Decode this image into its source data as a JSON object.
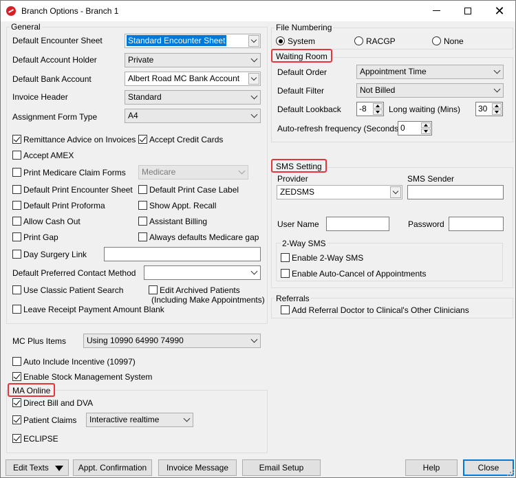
{
  "window": {
    "title": "Branch Options - Branch 1"
  },
  "general": {
    "legend": "General",
    "default_encounter_sheet": {
      "label": "Default Encounter Sheet",
      "value": "Standard Encounter Sheet"
    },
    "default_account_holder": {
      "label": "Default Account Holder",
      "value": "Private"
    },
    "default_bank_account": {
      "label": "Default Bank Account",
      "value": "Albert Road MC Bank Account"
    },
    "invoice_header": {
      "label": "Invoice Header",
      "value": "Standard"
    },
    "assignment_form_type": {
      "label": "Assignment Form Type",
      "value": "A4"
    },
    "remittance_advice": {
      "label": "Remittance Advice on Invoices",
      "checked": true
    },
    "accept_credit_cards": {
      "label": "Accept Credit Cards",
      "checked": true
    },
    "accept_amex": {
      "label": "Accept AMEX",
      "checked": false
    },
    "print_medicare_claim_forms": {
      "label": "Print Medicare Claim Forms",
      "checked": false
    },
    "medicare_select": {
      "value": "Medicare"
    },
    "default_print_encounter_sheet": {
      "label": "Default Print Encounter Sheet",
      "checked": false
    },
    "default_print_case_label": {
      "label": "Default Print Case Label",
      "checked": false
    },
    "default_print_proforma": {
      "label": "Default Print Proforma",
      "checked": false
    },
    "show_appt_recall": {
      "label": "Show Appt. Recall",
      "checked": false
    },
    "allow_cash_out": {
      "label": "Allow Cash Out",
      "checked": false
    },
    "assistant_billing": {
      "label": "Assistant Billing",
      "checked": false
    },
    "print_gap": {
      "label": "Print Gap",
      "checked": false
    },
    "always_defaults_medicare_gap": {
      "label": "Always defaults Medicare gap",
      "checked": false
    },
    "day_surgery_link": {
      "label": "Day Surgery Link",
      "checked": false
    },
    "default_preferred_contact": {
      "label": "Default Preferred Contact Method",
      "value": ""
    },
    "use_classic_patient_search": {
      "label": "Use Classic Patient Search",
      "checked": false
    },
    "edit_archived_patients": {
      "label": "Edit Archived Patients",
      "sublabel": "(Including Make Appointments)",
      "checked": false
    },
    "leave_receipt_blank": {
      "label": "Leave Receipt Payment Amount Blank",
      "checked": false
    }
  },
  "mc_plus": {
    "label": "MC Plus Items",
    "value": "Using 10990 64990 74990",
    "auto_include_incentive": {
      "label": "Auto Include Incentive (10997)",
      "checked": false
    },
    "enable_stock_management": {
      "label": "Enable Stock Management System",
      "checked": true
    }
  },
  "ma_online": {
    "legend": "MA Online",
    "direct_bill_dva": {
      "label": "Direct Bill and DVA",
      "checked": true
    },
    "patient_claims": {
      "label": "Patient Claims",
      "checked": true,
      "mode": "Interactive realtime"
    },
    "eclipse": {
      "label": "ECLIPSE",
      "checked": true
    }
  },
  "file_numbering": {
    "legend": "File Numbering",
    "options": [
      {
        "label": "System",
        "selected": true
      },
      {
        "label": "RACGP",
        "selected": false
      },
      {
        "label": "None",
        "selected": false
      }
    ]
  },
  "waiting_room": {
    "legend": "Waiting Room",
    "default_order": {
      "label": "Default Order",
      "value": "Appointment Time"
    },
    "default_filter": {
      "label": "Default Filter",
      "value": "Not Billed"
    },
    "default_lookback": {
      "label": "Default Lookback",
      "value": "-8"
    },
    "long_waiting": {
      "label": "Long waiting (Mins)",
      "value": "30"
    },
    "auto_refresh": {
      "label": "Auto-refresh frequency (Seconds)",
      "value": "0"
    }
  },
  "sms": {
    "legend": "SMS Setting",
    "provider": {
      "label": "Provider",
      "value": "ZEDSMS"
    },
    "sender": {
      "label": "SMS Sender",
      "value": ""
    },
    "user_name": {
      "label": "User Name",
      "value": ""
    },
    "password": {
      "label": "Password",
      "value": ""
    },
    "two_way": {
      "legend": "2-Way SMS",
      "enable_two_way": {
        "label": "Enable 2-Way SMS",
        "checked": false
      },
      "enable_auto_cancel": {
        "label": "Enable Auto-Cancel of Appointments",
        "checked": false
      }
    }
  },
  "referrals": {
    "legend": "Referrals",
    "add_referral_doctor": {
      "label": "Add Referral Doctor to Clinical's Other Clinicians",
      "checked": false
    }
  },
  "footer": {
    "edit_texts": "Edit Texts",
    "appt_confirmation": "Appt. Confirmation",
    "invoice_message": "Invoice Message",
    "email_setup": "Email Setup",
    "help": "Help",
    "close": "Close"
  },
  "colors": {
    "highlight": "#e8323c",
    "selection": "#0078d7"
  }
}
